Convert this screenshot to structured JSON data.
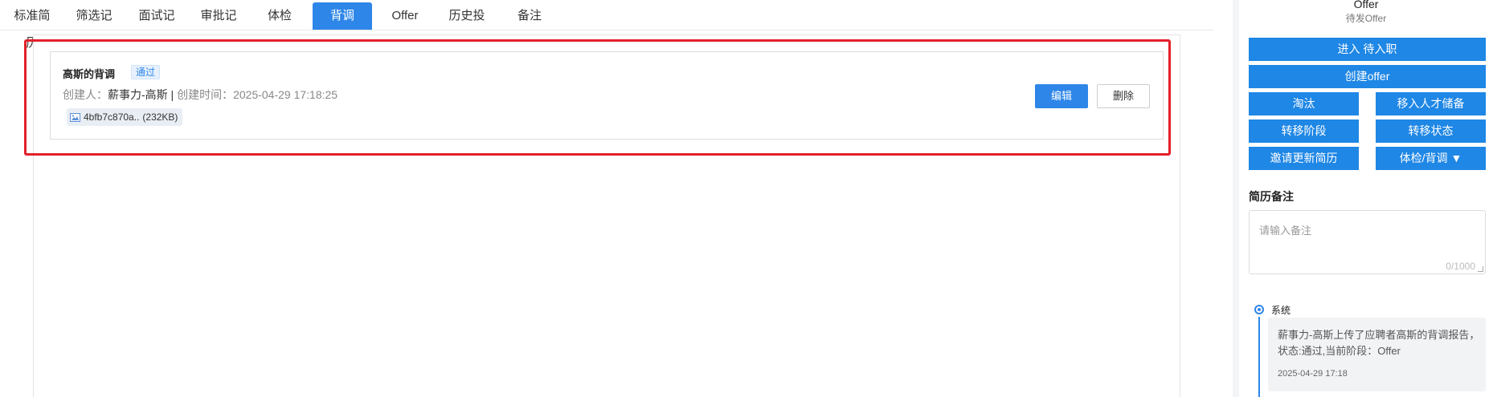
{
  "tabs": [
    {
      "label": "标准简历"
    },
    {
      "label": "筛选记录"
    },
    {
      "label": "面试记录"
    },
    {
      "label": "审批记录"
    },
    {
      "label": "体检"
    },
    {
      "label": "背调",
      "active": true
    },
    {
      "label": "Offer"
    },
    {
      "label": "历史投递"
    },
    {
      "label": "备注"
    }
  ],
  "background_check": {
    "title": "高斯的背调",
    "status": "通过",
    "creator_label": "创建人：",
    "creator": "薪事力-高斯",
    "separator": " | ",
    "created_label": "创建时间：",
    "created_time": "2025-04-29 17:18:25",
    "attachment": {
      "name": "4bfb7c870a..",
      "size": "(232KB)",
      "icon": "image-icon"
    },
    "edit_label": "编辑",
    "delete_label": "删除"
  },
  "sidebar": {
    "stage": "Offer",
    "sub_stage": "待发Offer",
    "buttons": {
      "enter_pending": "进入 待入职",
      "create_offer": "创建offer",
      "eliminate": "淘汰",
      "talent_pool": "移入人才储备",
      "move_stage": "转移阶段",
      "move_status": "转移状态",
      "invite_update": "邀请更新简历",
      "check_menu": "体检/背调 ▼"
    },
    "remark_title": "简历备注",
    "remark_placeholder": "请输入备注",
    "remark_count": "0/1000",
    "timeline": [
      {
        "source": "系统",
        "message": "薪事力-高斯上传了应聘者高斯的背调报告，状态:通过,当前阶段：Offer",
        "time": "2025-04-29 17:18"
      }
    ]
  },
  "colors": {
    "accent": "#2e86e8",
    "highlight": "#e3202a"
  }
}
